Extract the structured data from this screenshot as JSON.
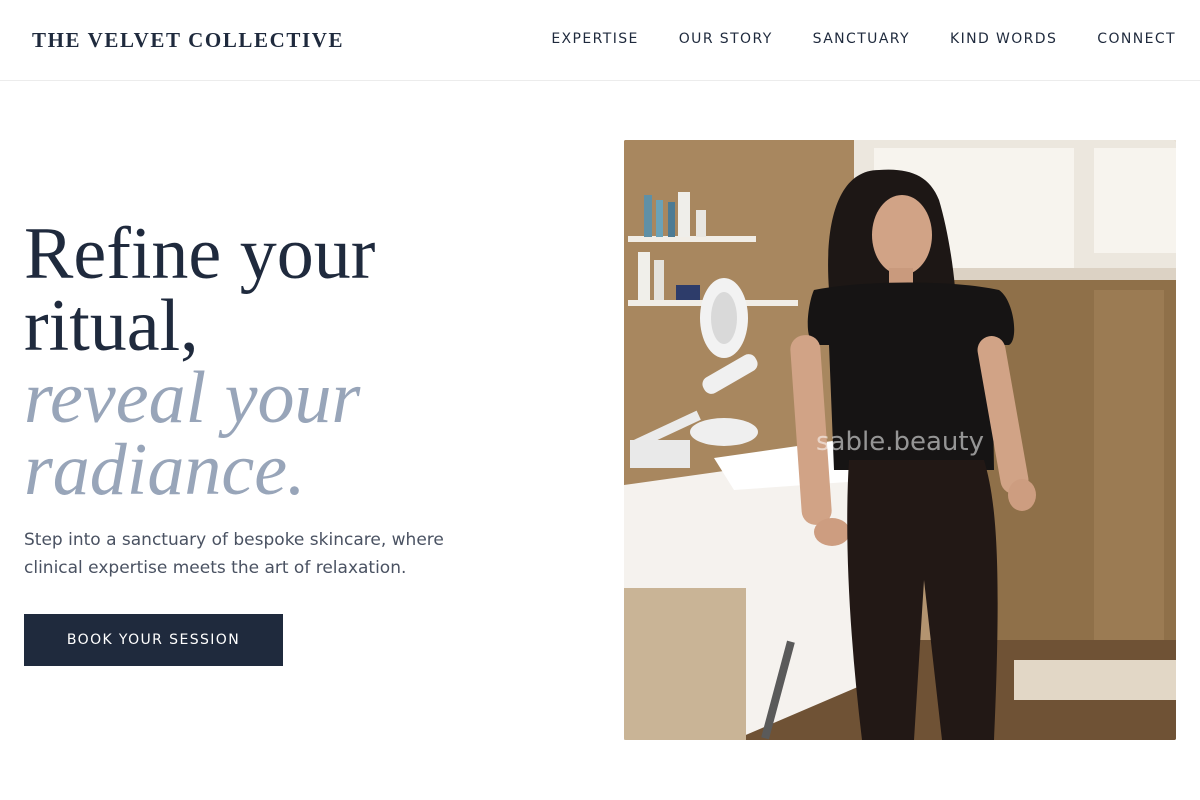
{
  "brand": {
    "name": "THE VELVET COLLECTIVE"
  },
  "nav": {
    "items": [
      {
        "label": "EXPERTISE"
      },
      {
        "label": "OUR STORY"
      },
      {
        "label": "SANCTUARY"
      },
      {
        "label": "KIND WORDS"
      },
      {
        "label": "CONNECT"
      }
    ]
  },
  "hero": {
    "headline_line1": "Refine your",
    "headline_line2": "ritual,",
    "headline_line3": "reveal your",
    "headline_line4": "radiance.",
    "subtext": "Step into a sanctuary of bespoke skincare, where clinical expertise meets the art of relaxation.",
    "cta_label": "BOOK YOUR SESSION",
    "image_watermark": "sable.beauty"
  },
  "colors": {
    "primary_navy": "#1f2a3d",
    "accent_slate": "#98a5b9",
    "body_text": "#4a5262"
  }
}
